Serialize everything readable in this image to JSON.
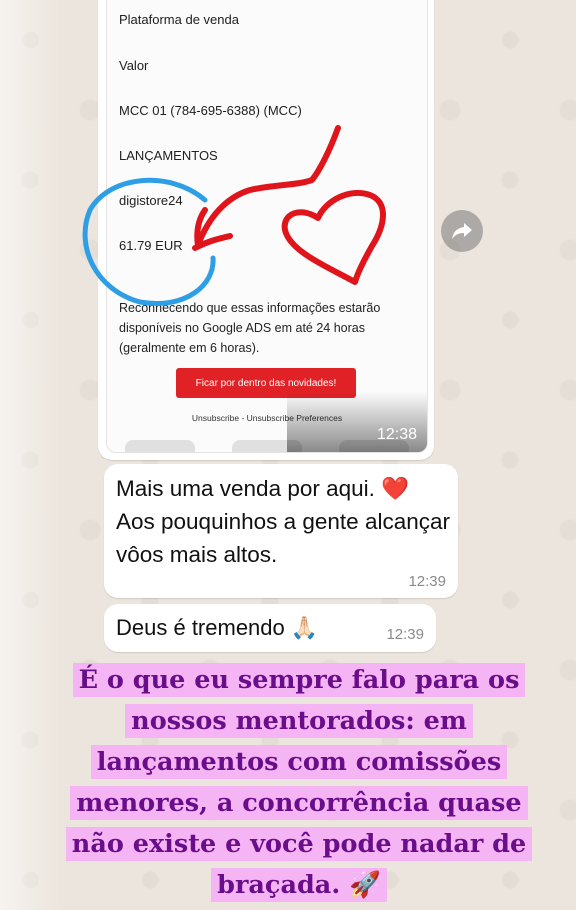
{
  "image_message": {
    "rows": [
      "Plataforma de venda",
      "Valor",
      "MCC 01 (784-695-6388) (MCC)",
      "LANÇAMENTOS",
      "digistore24",
      "61.79 EUR"
    ],
    "note": "Reconhecendo que essas informações estarão disponíveis no Google ADS em até 24 horas (geralmente em 6 horas).",
    "cta_label": "Ficar por dentro das novidades!",
    "unsubscribe_text": "Unsubscribe - Unsubscribe Preferences",
    "time": "12:38"
  },
  "forward_icon": "forward-arrow-icon",
  "messages": [
    {
      "text": "Mais uma venda por aqui. ",
      "emoji": "❤️",
      "line2": "Aos pouquinhos a gente alcançar vôos mais altos.",
      "time": "12:39"
    },
    {
      "text": "Deus é tremendo ",
      "emoji": "🙏🏻",
      "time": "12:39"
    }
  ],
  "caption": {
    "text": "É o que eu sempre falo para os nossos mentorados: em lançamentos com comissões menores, a concorrência quase não existe e você pode nadar de braçada. 🚀"
  },
  "colors": {
    "annotation_red": "#e0151c",
    "annotation_blue": "#2e9fe6",
    "caption_highlight": "#f5b4f4",
    "caption_text": "#6a0d8a",
    "cta_red": "#e02227"
  }
}
